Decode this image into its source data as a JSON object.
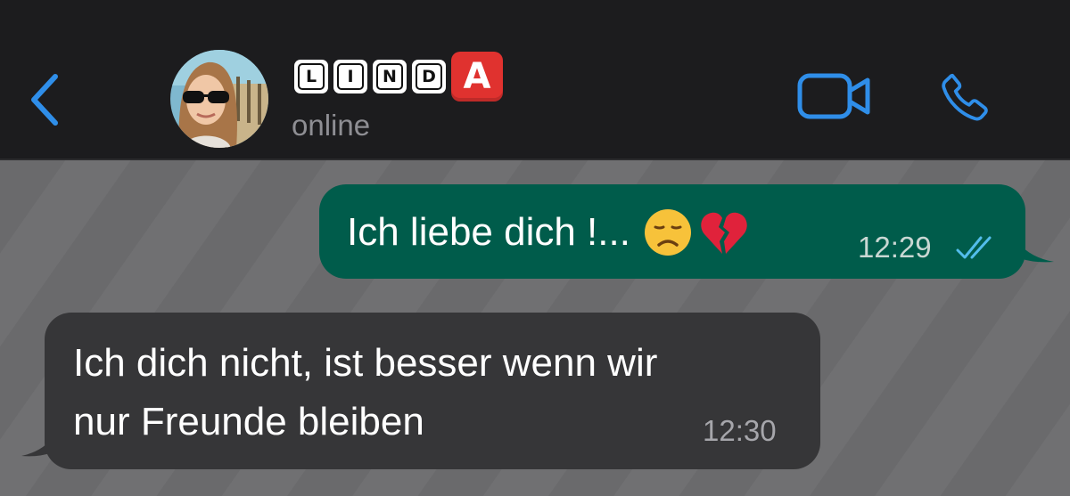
{
  "header": {
    "contact_name_letters": [
      "L",
      "I",
      "N",
      "D",
      "A"
    ],
    "status": "online"
  },
  "messages": [
    {
      "direction": "outgoing",
      "text": "Ich liebe dich !...",
      "emojis": [
        "disappointed-face-emoji",
        "broken-heart-emoji"
      ],
      "time": "12:29",
      "read": true
    },
    {
      "direction": "incoming",
      "text": "Ich dich nicht, ist besser wenn wir\nnur Freunde bleiben",
      "time": "12:30"
    }
  ],
  "icons": {
    "back": "chevron-left-icon",
    "video": "video-camera-icon",
    "call": "phone-icon",
    "read_receipt": "double-check-icon"
  },
  "colors": {
    "accent": "#2f8ee9",
    "header_bg": "#1c1c1e",
    "chat_bg": "#6f6f71",
    "outgoing_bubble": "#005c4b",
    "incoming_bubble": "#363638",
    "name_red_tile": "#e0322f"
  }
}
